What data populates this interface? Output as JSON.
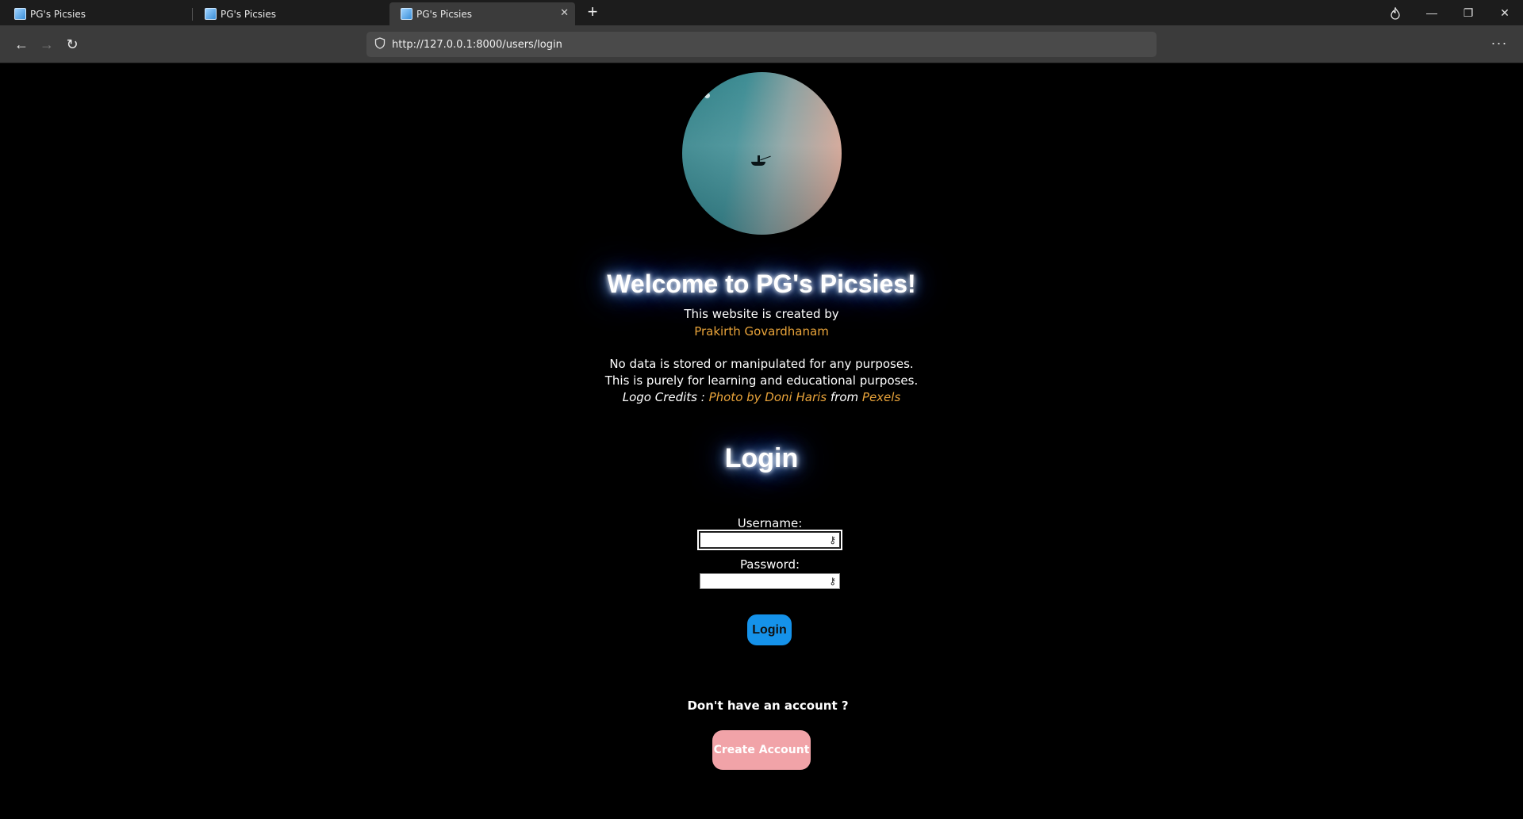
{
  "browser": {
    "tabs": [
      {
        "title": "PG's Picsies"
      },
      {
        "title": "PG's Picsies"
      },
      {
        "title": "PG's Picsies"
      }
    ],
    "address": "http://127.0.0.1:8000/users/login",
    "icons": {
      "back": "arrow-left",
      "forward": "arrow-right",
      "reload": "reload",
      "menu": "more-horizontal",
      "new_tab": "plus",
      "burn": "flame"
    }
  },
  "page": {
    "logo_alt": "Logo",
    "welcome": "Welcome to PG's Picsies!",
    "created_by": "This website is created by",
    "author": "Prakirth Govardhanam",
    "disclaimer_1": "No data is stored or manipulated for any purposes.",
    "disclaimer_2": "This is purely for learning and educational purposes.",
    "credits_label": "Logo Credits :",
    "credits_photo": "Photo by Doni Haris",
    "credits_from": "from",
    "credits_site": "Pexels",
    "login_heading": "Login",
    "username_label": "Username:",
    "username_value": "",
    "password_label": "Password:",
    "password_value": "",
    "login_button": "Login",
    "no_account": "Don't have an account ?",
    "create_account_button": "Create Account"
  },
  "colors": {
    "background": "#000000",
    "link_orange": "#e8a33a",
    "login_button": "#1592ea",
    "create_account_button": "#f1a3a8",
    "glow": "#3a7bff"
  }
}
